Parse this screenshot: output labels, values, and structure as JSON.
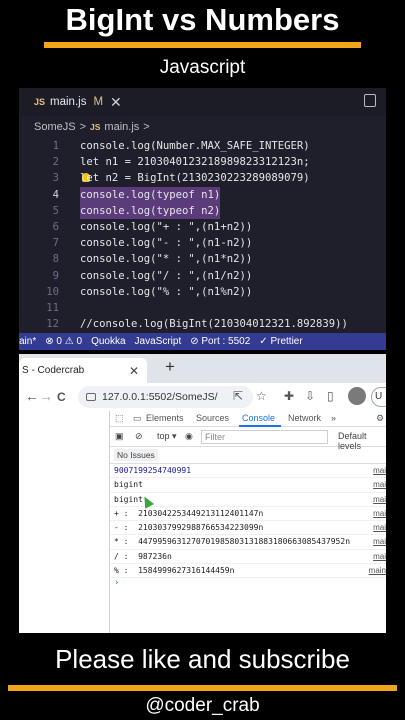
{
  "header": {
    "title": "BigInt vs Numbers",
    "subtitle": "Javascript"
  },
  "editor": {
    "tab": {
      "file_label": "main.js",
      "js_badge": "JS",
      "modified": "M",
      "close": "✕"
    },
    "breadcrumb": {
      "folder": "SomeJS",
      "sep": ">",
      "js_badge": "JS",
      "file": "main.js",
      "more": ">"
    },
    "lines": [
      {
        "num": "1",
        "code": "console.log(Number.MAX_SAFE_INTEGER)"
      },
      {
        "num": "2",
        "code": "let n1 = 2103040123218989823312123n;"
      },
      {
        "num": "3",
        "code": "let n2 = BigInt(2130230223289089079)"
      },
      {
        "num": "4",
        "code": "console.log(typeof n1)"
      },
      {
        "num": "5",
        "code": "console.log(typeof n2)"
      },
      {
        "num": "6",
        "code": "console.log(\"+ : \",(n1+n2))"
      },
      {
        "num": "7",
        "code": "console.log(\"- : \",(n1-n2))"
      },
      {
        "num": "8",
        "code": "console.log(\"* : \",(n1*n2))"
      },
      {
        "num": "9",
        "code": "console.log(\"/ : \",(n1/n2))"
      },
      {
        "num": "10",
        "code": "console.log(\"% : \",(n1%n2))"
      },
      {
        "num": "11",
        "code": ""
      },
      {
        "num": "12",
        "code": "//console.log(BigInt(210304012321.892839))"
      }
    ]
  },
  "statusbar": {
    "branch": "ain*",
    "errors": "⊗ 0 ⚠ 0",
    "quokka": "Quokka",
    "language": "JavaScript",
    "port": "⊘ Port : 5502",
    "prettier": "✓ Prettier",
    "bell": "🔔"
  },
  "browser": {
    "tab_title": "S - Codercrab",
    "tab_close": "✕",
    "new_tab": "+",
    "back": "←",
    "forward": "→",
    "reload": "C",
    "url": "127.0.0.1:5502/SomeJS/",
    "profile_button": "U",
    "devtools": {
      "tabs": [
        "Elements",
        "Sources",
        "Console",
        "Network",
        "»"
      ],
      "context": "top ▾",
      "filter_placeholder": "Filter",
      "levels": "Default levels",
      "no_issues": "No Issues",
      "logs": [
        {
          "text": "9007199254740991",
          "src": "mai"
        },
        {
          "text": "bigint",
          "src": "mai"
        },
        {
          "text": "bigint",
          "src": "mai"
        },
        {
          "text": "+ :  2103042253449213112401147n",
          "src": "mai"
        },
        {
          "text": "- :  2103037992988766534223099n",
          "src": "mai"
        },
        {
          "text": "* :  4479959631270701985803131883180663085437952n",
          "src": "mai"
        },
        {
          "text": "/ :  987236n",
          "src": "mai"
        },
        {
          "text": "% :  1584999627316144459n",
          "src": "main"
        }
      ],
      "prompt": "›"
    }
  },
  "footer": {
    "cta": "Please like and subscribe",
    "handle": "@coder_crab"
  }
}
